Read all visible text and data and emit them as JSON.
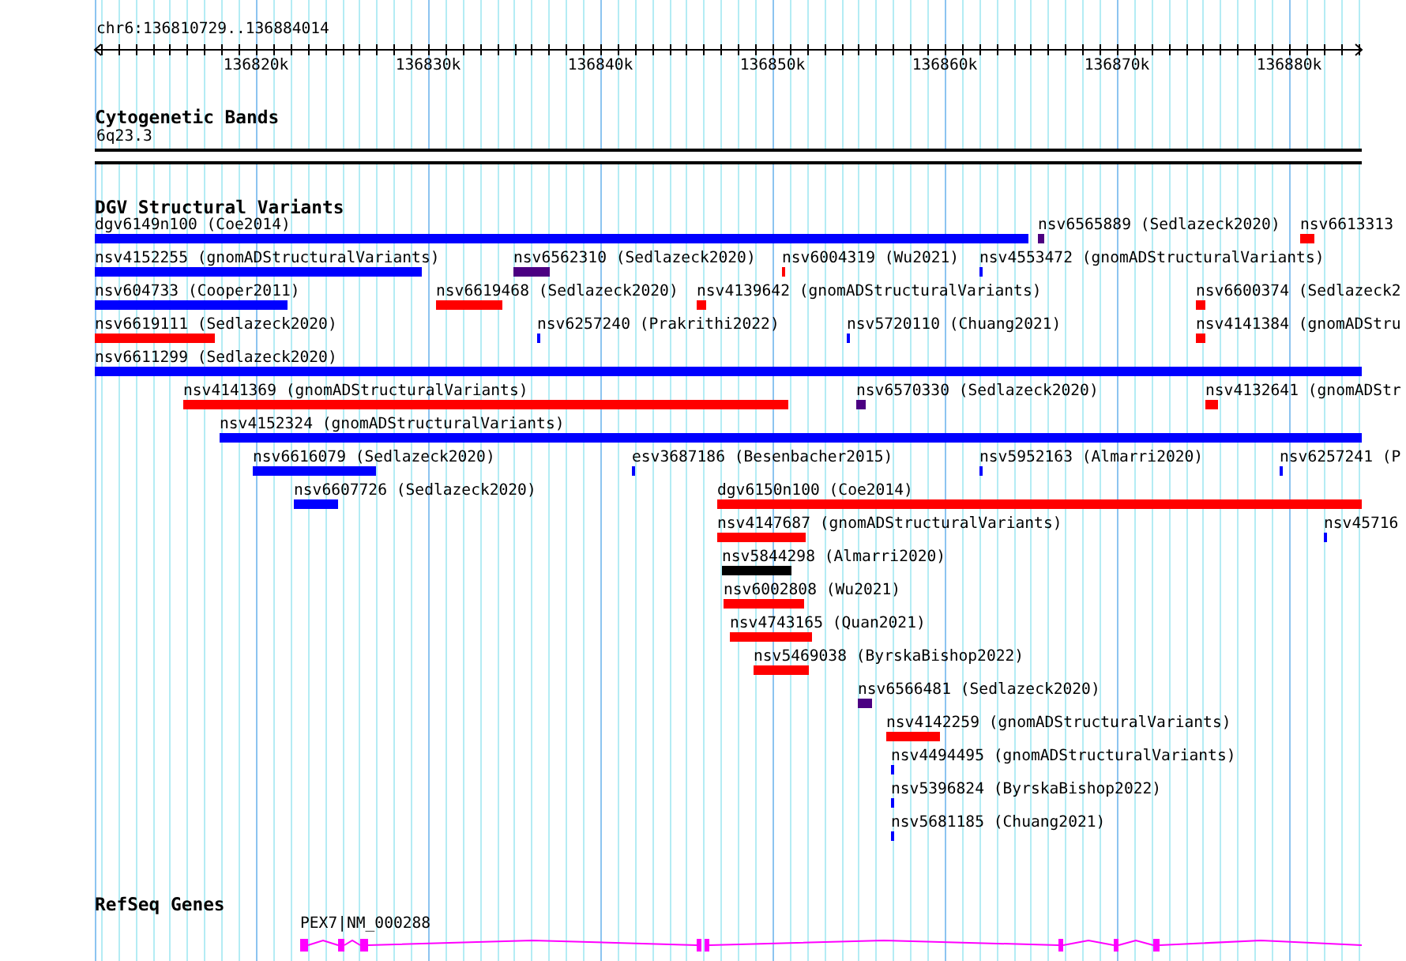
{
  "ruler": {
    "location": "chr6:136810729..136884014",
    "ticks": [
      "136820k",
      "136830k",
      "136840k",
      "136850k",
      "136860k",
      "136870k",
      "136880k"
    ]
  },
  "cytoband_track": {
    "title": "Cytogenetic Bands",
    "band": "6q23.3"
  },
  "variant_track": {
    "title": "DGV Structural Variants",
    "features": [
      {
        "label": "dgv6149n100 (Coe2014)",
        "color": "#0000ff"
      },
      {
        "label": "nsv6565889 (Sedlazeck2020)",
        "color": "#4b0082"
      },
      {
        "label": "nsv6613313",
        "color": "#ff0000"
      },
      {
        "label": "nsv4152255 (gnomADStructuralVariants)",
        "color": "#0000ff"
      },
      {
        "label": "nsv6562310 (Sedlazeck2020)",
        "color": "#4b0082"
      },
      {
        "label": "nsv6004319 (Wu2021)",
        "color": "#ff0000"
      },
      {
        "label": "nsv4553472 (gnomADStructuralVariants)",
        "color": "#0000ff"
      },
      {
        "label": "nsv604733 (Cooper2011)",
        "color": "#0000ff"
      },
      {
        "label": "nsv6619468 (Sedlazeck2020)",
        "color": "#ff0000"
      },
      {
        "label": "nsv4139642 (gnomADStructuralVariants)",
        "color": "#ff0000"
      },
      {
        "label": "nsv6600374 (Sedlazeck2",
        "color": "#ff0000"
      },
      {
        "label": "nsv6619111 (Sedlazeck2020)",
        "color": "#ff0000"
      },
      {
        "label": "nsv6257240 (Prakrithi2022)",
        "color": "#0000ff"
      },
      {
        "label": "nsv5720110 (Chuang2021)",
        "color": "#0000ff"
      },
      {
        "label": "nsv4141384 (gnomADStru",
        "color": "#ff0000"
      },
      {
        "label": "nsv6611299 (Sedlazeck2020)",
        "color": "#0000ff"
      },
      {
        "label": "nsv4141369 (gnomADStructuralVariants)",
        "color": "#ff0000"
      },
      {
        "label": "nsv6570330 (Sedlazeck2020)",
        "color": "#4b0082"
      },
      {
        "label": "nsv4132641 (gnomADStr",
        "color": "#ff0000"
      },
      {
        "label": "nsv4152324 (gnomADStructuralVariants)",
        "color": "#0000ff"
      },
      {
        "label": "nsv6616079 (Sedlazeck2020)",
        "color": "#0000ff"
      },
      {
        "label": "esv3687186 (Besenbacher2015)",
        "color": "#0000ff"
      },
      {
        "label": "nsv5952163 (Almarri2020)",
        "color": "#0000ff"
      },
      {
        "label": "nsv6257241 (P",
        "color": "#0000ff"
      },
      {
        "label": "nsv6607726 (Sedlazeck2020)",
        "color": "#0000ff"
      },
      {
        "label": "dgv6150n100 (Coe2014)",
        "color": "#ff0000"
      },
      {
        "label": "nsv4147687 (gnomADStructuralVariants)",
        "color": "#ff0000"
      },
      {
        "label": "nsv45716",
        "color": "#0000ff"
      },
      {
        "label": "nsv5844298 (Almarri2020)",
        "color": "#000000"
      },
      {
        "label": "nsv6002808 (Wu2021)",
        "color": "#ff0000"
      },
      {
        "label": "nsv4743165 (Quan2021)",
        "color": "#ff0000"
      },
      {
        "label": "nsv5469038 (ByrskaBishop2022)",
        "color": "#ff0000"
      },
      {
        "label": "nsv6566481 (Sedlazeck2020)",
        "color": "#4b0082"
      },
      {
        "label": "nsv4142259 (gnomADStructuralVariants)",
        "color": "#ff0000"
      },
      {
        "label": "nsv4494495 (gnomADStructuralVariants)",
        "color": "#0000ff"
      },
      {
        "label": "nsv5396824 (ByrskaBishop2022)",
        "color": "#0000ff"
      },
      {
        "label": "nsv5681185 (Chuang2021)",
        "color": "#0000ff"
      }
    ]
  },
  "gene_track": {
    "title": "RefSeq Genes",
    "genes": [
      {
        "label": "PEX7|NM_000288"
      }
    ]
  }
}
